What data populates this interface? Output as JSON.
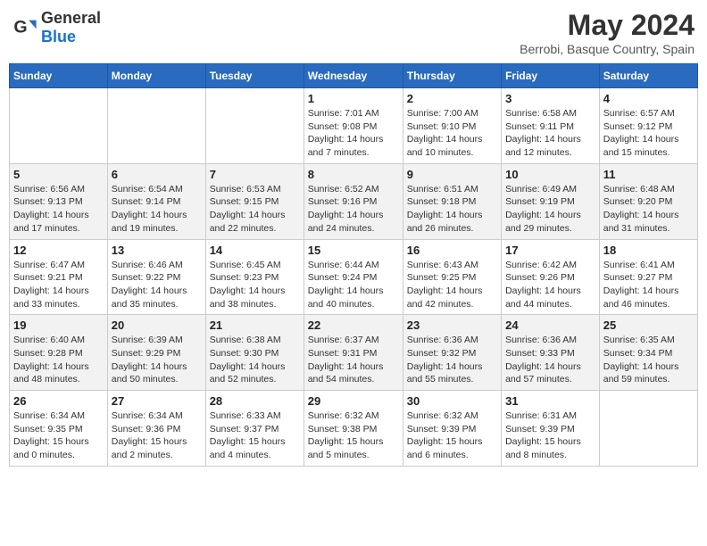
{
  "header": {
    "logo_general": "General",
    "logo_blue": "Blue",
    "month": "May 2024",
    "location": "Berrobi, Basque Country, Spain"
  },
  "days_of_week": [
    "Sunday",
    "Monday",
    "Tuesday",
    "Wednesday",
    "Thursday",
    "Friday",
    "Saturday"
  ],
  "weeks": [
    [
      {
        "day": "",
        "info": ""
      },
      {
        "day": "",
        "info": ""
      },
      {
        "day": "",
        "info": ""
      },
      {
        "day": "1",
        "info": "Sunrise: 7:01 AM\nSunset: 9:08 PM\nDaylight: 14 hours\nand 7 minutes."
      },
      {
        "day": "2",
        "info": "Sunrise: 7:00 AM\nSunset: 9:10 PM\nDaylight: 14 hours\nand 10 minutes."
      },
      {
        "day": "3",
        "info": "Sunrise: 6:58 AM\nSunset: 9:11 PM\nDaylight: 14 hours\nand 12 minutes."
      },
      {
        "day": "4",
        "info": "Sunrise: 6:57 AM\nSunset: 9:12 PM\nDaylight: 14 hours\nand 15 minutes."
      }
    ],
    [
      {
        "day": "5",
        "info": "Sunrise: 6:56 AM\nSunset: 9:13 PM\nDaylight: 14 hours\nand 17 minutes."
      },
      {
        "day": "6",
        "info": "Sunrise: 6:54 AM\nSunset: 9:14 PM\nDaylight: 14 hours\nand 19 minutes."
      },
      {
        "day": "7",
        "info": "Sunrise: 6:53 AM\nSunset: 9:15 PM\nDaylight: 14 hours\nand 22 minutes."
      },
      {
        "day": "8",
        "info": "Sunrise: 6:52 AM\nSunset: 9:16 PM\nDaylight: 14 hours\nand 24 minutes."
      },
      {
        "day": "9",
        "info": "Sunrise: 6:51 AM\nSunset: 9:18 PM\nDaylight: 14 hours\nand 26 minutes."
      },
      {
        "day": "10",
        "info": "Sunrise: 6:49 AM\nSunset: 9:19 PM\nDaylight: 14 hours\nand 29 minutes."
      },
      {
        "day": "11",
        "info": "Sunrise: 6:48 AM\nSunset: 9:20 PM\nDaylight: 14 hours\nand 31 minutes."
      }
    ],
    [
      {
        "day": "12",
        "info": "Sunrise: 6:47 AM\nSunset: 9:21 PM\nDaylight: 14 hours\nand 33 minutes."
      },
      {
        "day": "13",
        "info": "Sunrise: 6:46 AM\nSunset: 9:22 PM\nDaylight: 14 hours\nand 35 minutes."
      },
      {
        "day": "14",
        "info": "Sunrise: 6:45 AM\nSunset: 9:23 PM\nDaylight: 14 hours\nand 38 minutes."
      },
      {
        "day": "15",
        "info": "Sunrise: 6:44 AM\nSunset: 9:24 PM\nDaylight: 14 hours\nand 40 minutes."
      },
      {
        "day": "16",
        "info": "Sunrise: 6:43 AM\nSunset: 9:25 PM\nDaylight: 14 hours\nand 42 minutes."
      },
      {
        "day": "17",
        "info": "Sunrise: 6:42 AM\nSunset: 9:26 PM\nDaylight: 14 hours\nand 44 minutes."
      },
      {
        "day": "18",
        "info": "Sunrise: 6:41 AM\nSunset: 9:27 PM\nDaylight: 14 hours\nand 46 minutes."
      }
    ],
    [
      {
        "day": "19",
        "info": "Sunrise: 6:40 AM\nSunset: 9:28 PM\nDaylight: 14 hours\nand 48 minutes."
      },
      {
        "day": "20",
        "info": "Sunrise: 6:39 AM\nSunset: 9:29 PM\nDaylight: 14 hours\nand 50 minutes."
      },
      {
        "day": "21",
        "info": "Sunrise: 6:38 AM\nSunset: 9:30 PM\nDaylight: 14 hours\nand 52 minutes."
      },
      {
        "day": "22",
        "info": "Sunrise: 6:37 AM\nSunset: 9:31 PM\nDaylight: 14 hours\nand 54 minutes."
      },
      {
        "day": "23",
        "info": "Sunrise: 6:36 AM\nSunset: 9:32 PM\nDaylight: 14 hours\nand 55 minutes."
      },
      {
        "day": "24",
        "info": "Sunrise: 6:36 AM\nSunset: 9:33 PM\nDaylight: 14 hours\nand 57 minutes."
      },
      {
        "day": "25",
        "info": "Sunrise: 6:35 AM\nSunset: 9:34 PM\nDaylight: 14 hours\nand 59 minutes."
      }
    ],
    [
      {
        "day": "26",
        "info": "Sunrise: 6:34 AM\nSunset: 9:35 PM\nDaylight: 15 hours\nand 0 minutes."
      },
      {
        "day": "27",
        "info": "Sunrise: 6:34 AM\nSunset: 9:36 PM\nDaylight: 15 hours\nand 2 minutes."
      },
      {
        "day": "28",
        "info": "Sunrise: 6:33 AM\nSunset: 9:37 PM\nDaylight: 15 hours\nand 4 minutes."
      },
      {
        "day": "29",
        "info": "Sunrise: 6:32 AM\nSunset: 9:38 PM\nDaylight: 15 hours\nand 5 minutes."
      },
      {
        "day": "30",
        "info": "Sunrise: 6:32 AM\nSunset: 9:39 PM\nDaylight: 15 hours\nand 6 minutes."
      },
      {
        "day": "31",
        "info": "Sunrise: 6:31 AM\nSunset: 9:39 PM\nDaylight: 15 hours\nand 8 minutes."
      },
      {
        "day": "",
        "info": ""
      }
    ]
  ]
}
